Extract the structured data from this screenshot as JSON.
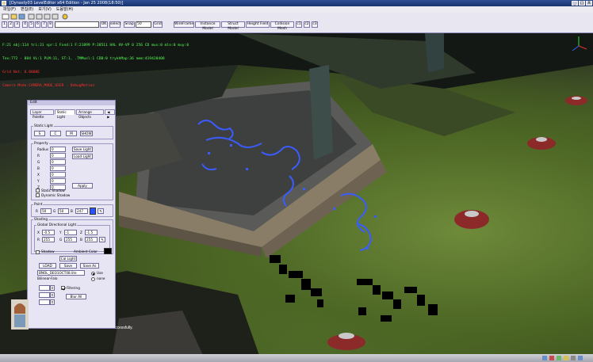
{
  "window": {
    "title": "[Dynasty03 LevelEditor x64 Edition - Jan 25 2008(18:50)]",
    "controls": [
      "_",
      "□",
      "X"
    ]
  },
  "menu": [
    "파일(F)",
    "편집(E)",
    "보기(V)",
    "도움말(H)"
  ],
  "toolbar": {
    "left_buttons": [
      "1",
      "2",
      "3",
      "4",
      "5",
      "6",
      "7",
      "8"
    ],
    "ok_label": "OK",
    "select_label": "select",
    "snap_label": "Snap",
    "snap_value": "50",
    "grid_label": "Grid",
    "view_buttons": [
      "WireFrame",
      "Instance Model",
      "Struct Model",
      "Height Field",
      "Collision Mesh",
      "c1",
      "c2",
      "c3"
    ]
  },
  "hud": {
    "line1": "F:21 obj:114 tri:31 spr:1 Fxnd:1 F:21899 P:38511 HAL HV-VP 0 256 CD mus:0 mln:0 muy:0",
    "line2": "Tex:772 - 884 VL:1 PLM:11, ST:1, .TMMusl:1 CDB:0 trykhMap:36 mem:419420408",
    "line3": "Grid Nxt: 0.0000E",
    "line4": "Camera Mode:CAMERA_MODE_USER - DebugMotion"
  },
  "panel": {
    "title": "Edit",
    "tabs": [
      "Layer Palette",
      "Static Light",
      "Arrange Objects",
      "◀ ▶"
    ],
    "static_light": {
      "group_label": "Static Light",
      "buttons": [
        "S",
        "C",
        "M",
        "SHOW"
      ]
    },
    "property": {
      "group_label": "Property",
      "fields": [
        {
          "label": "Radius",
          "value": "0"
        },
        {
          "label": "R",
          "value": "0"
        },
        {
          "label": "G",
          "value": "0"
        },
        {
          "label": "B",
          "value": "0"
        },
        {
          "label": "X",
          "value": "0"
        },
        {
          "label": "Y",
          "value": "0"
        },
        {
          "label": "Z",
          "value": "0"
        }
      ],
      "save_light": "Save Light",
      "load_light": "Load Light",
      "apply": "Apply",
      "static_shadow": "Static Shadow",
      "dynamic_shadow": "Dynamic Shadow"
    },
    "paint": {
      "group_label": "Paint",
      "r_label": "R",
      "r_value": "50",
      "g_label": "G",
      "g_value": "50",
      "b_label": "B",
      "b_value": "247",
      "swatch_color": "#2a52ff"
    },
    "shading": {
      "group_label": "Shading",
      "gdl_label": "Global Directional Light",
      "x_label": "X",
      "x_value": "-0.5",
      "y_label": "Y",
      "y_value": "-1",
      "z_label": "Z",
      "z_value": "-1.5",
      "r_label": "R",
      "r_value": "255",
      "g_label": "G",
      "g_value": "255",
      "b_label": "B",
      "b_value": "255",
      "shadow": "Shadow",
      "ambient_color": "Ambient Color",
      "ambient_swatch": "#000000",
      "calc_light": "Cal Light",
      "load": "LOAD",
      "save": "Save",
      "save_as": "Save As",
      "file_path": "BNOL_DEO1OCT08.lite",
      "bilinear": "Bilinear-Falo",
      "use_label": "Use",
      "none_label": "none",
      "filtering": "Filtering",
      "blur_all": "Blur All"
    }
  },
  "console": {
    "text": "ccessfully."
  },
  "colors": {
    "hud_green": "#55ff55",
    "hud_red": "#ff3030",
    "panel_bg": "#e7e4f4",
    "title_blue": "#19336e"
  }
}
